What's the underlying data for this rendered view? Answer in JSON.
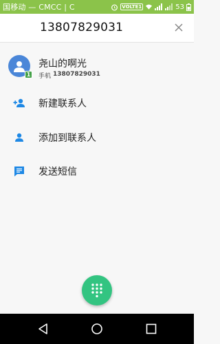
{
  "status_bar": {
    "carrier": "国移动 — CMCC | C",
    "volte": "VOLTE1",
    "battery": "53",
    "bg_color": "#8bc34a"
  },
  "header": {
    "phone_number": "13807829031",
    "close_icon": "close-icon"
  },
  "contact": {
    "name": "尧山的啊光",
    "type_label": "手机",
    "number": "13807829031",
    "sim_badge": "1",
    "avatar_color": "#4a86d8"
  },
  "actions": [
    {
      "icon": "add-person-icon",
      "label": "新建联系人"
    },
    {
      "icon": "person-icon",
      "label": "添加到联系人"
    },
    {
      "icon": "message-icon",
      "label": "发送短信"
    }
  ],
  "fab": {
    "icon": "dialpad-icon",
    "color": "#33c481"
  },
  "nav": {
    "back": "back-icon",
    "home": "home-icon",
    "recents": "recents-icon"
  },
  "accent_color": "#1e88e5"
}
